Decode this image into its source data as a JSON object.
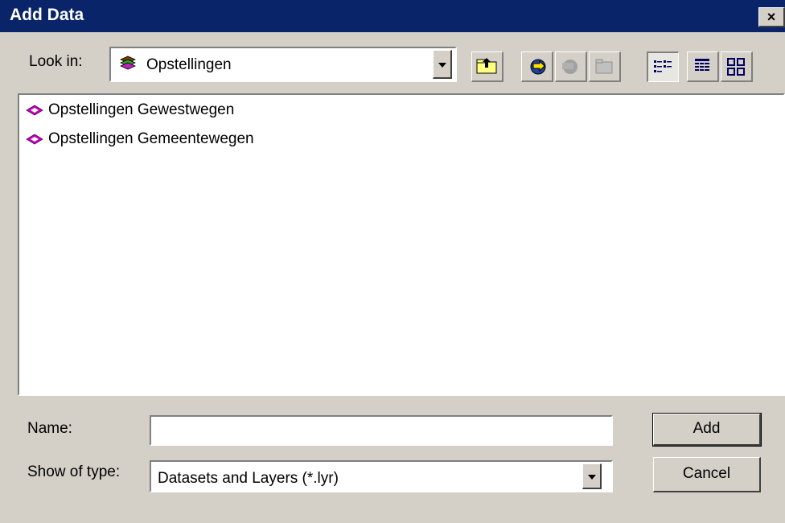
{
  "window": {
    "title": "Add Data",
    "close_glyph": "×"
  },
  "look_in": {
    "label": "Look in:",
    "value": "Opstellingen",
    "icon": "layer-stack-icon"
  },
  "toolbar": [
    {
      "name": "up-one-level-button",
      "icon": "folder-up-icon"
    },
    {
      "name": "connect-to-folder-button",
      "icon": "connect-folder-icon"
    },
    {
      "name": "disconnect-folder-button",
      "icon": "disconnect-folder-icon"
    },
    {
      "name": "new-folder-button",
      "icon": "new-folder-icon"
    },
    {
      "name": "list-view-button",
      "icon": "list-view-icon",
      "pressed": true
    },
    {
      "name": "details-view-button",
      "icon": "details-view-icon"
    },
    {
      "name": "thumbnails-view-button",
      "icon": "thumbnails-view-icon"
    }
  ],
  "files": [
    {
      "label": "Opstellingen Gewestwegen",
      "icon": "layer-icon"
    },
    {
      "label": "Opstellingen Gemeentewegen",
      "icon": "layer-icon"
    }
  ],
  "name_field": {
    "label": "Name:",
    "value": ""
  },
  "type_field": {
    "label": "Show of type:",
    "value": "Datasets and Layers (*.lyr)"
  },
  "buttons": {
    "add": "Add",
    "cancel": "Cancel"
  },
  "colors": {
    "titlebar": "#0a246a",
    "dialog": "#d4d0c8",
    "layer_icon": "#c000c0"
  }
}
